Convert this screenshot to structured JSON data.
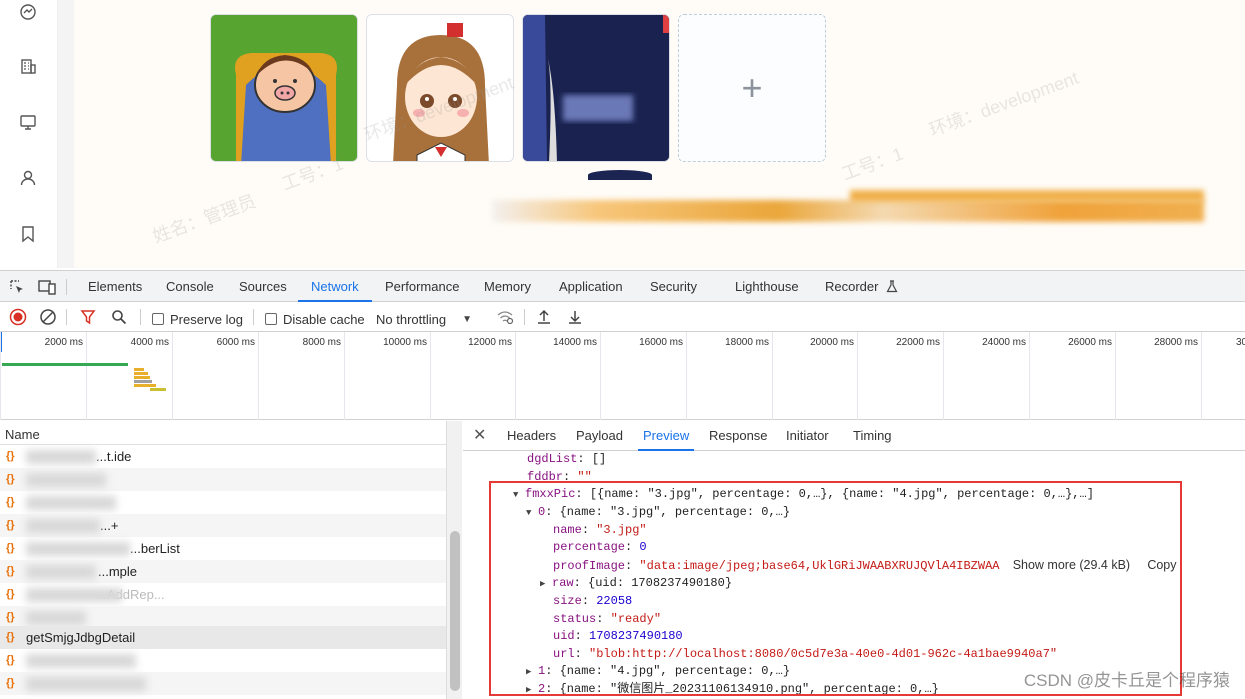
{
  "app": {
    "sidebar_icons": [
      "dashboard-icon",
      "building-icon",
      "monitor-icon",
      "user-icon",
      "bookmark-icon"
    ],
    "upload_plus": "+",
    "watermarks": [
      "姓名：管理员",
      "工号：1",
      "环境：development"
    ]
  },
  "devtools": {
    "tabs": [
      "Elements",
      "Console",
      "Sources",
      "Network",
      "Performance",
      "Memory",
      "Application",
      "Security",
      "Lighthouse",
      "Recorder"
    ],
    "active_tab": "Network",
    "recorder_icon": "flask-icon",
    "toolbar": {
      "preserve_log": "Preserve log",
      "disable_cache": "Disable cache",
      "throttling": "No throttling"
    },
    "timeline_ticks": [
      "2000 ms",
      "4000 ms",
      "6000 ms",
      "8000 ms",
      "10000 ms",
      "12000 ms",
      "14000 ms",
      "16000 ms",
      "18000 ms",
      "20000 ms",
      "22000 ms",
      "24000 ms",
      "26000 ms",
      "28000 ms",
      "30"
    ],
    "requests": {
      "header": "Name",
      "rows": [
        "...t.ide",
        "",
        "",
        "...+",
        "...berList",
        "...mple",
        "...AddRep...",
        "getSmjgJdbgDetail",
        "",
        ""
      ],
      "selected": "getSmjgJdbgDetail"
    },
    "detail_tabs": [
      "Headers",
      "Payload",
      "Preview",
      "Response",
      "Initiator",
      "Timing"
    ],
    "active_detail_tab": "Preview",
    "preview": {
      "l1_key": "dgdList",
      "l1_val": "[]",
      "l2_key": "fddbr",
      "l2_val": "\"\"",
      "l3_key": "fmxxPic",
      "l3_val": "[{name: \"3.jpg\", percentage: 0,…}, {name: \"4.jpg\", percentage: 0,…},…]",
      "l4_key": "0",
      "l4_val": "{name: \"3.jpg\", percentage: 0,…}",
      "name_key": "name",
      "name_val": "\"3.jpg\"",
      "pct_key": "percentage",
      "pct_val": "0",
      "proof_key": "proofImage",
      "proof_val": "\"data:image/jpeg;base64,UklGRiJWAABXRUJQVlA4IBZWAA",
      "show_more": "Show more (29.4 kB)",
      "copy": "Copy",
      "raw_key": "raw",
      "raw_val": "{uid: 1708237490180}",
      "size_key": "size",
      "size_val": "22058",
      "status_key": "status",
      "status_val": "\"ready\"",
      "uid_key": "uid",
      "uid_val": "1708237490180",
      "url_key": "url",
      "url_val": "\"blob:http://localhost:8080/0c5d7e3a-40e0-4d01-962c-4a1bae9940a7\"",
      "i1_key": "1",
      "i1_val": "{name: \"4.jpg\", percentage: 0,…}",
      "i2_key": "2",
      "i2_val": "{name: \"微信图片_20231106134910.png\", percentage: 0,…}"
    }
  },
  "footer_watermark": "CSDN @皮卡丘是个程序猿"
}
